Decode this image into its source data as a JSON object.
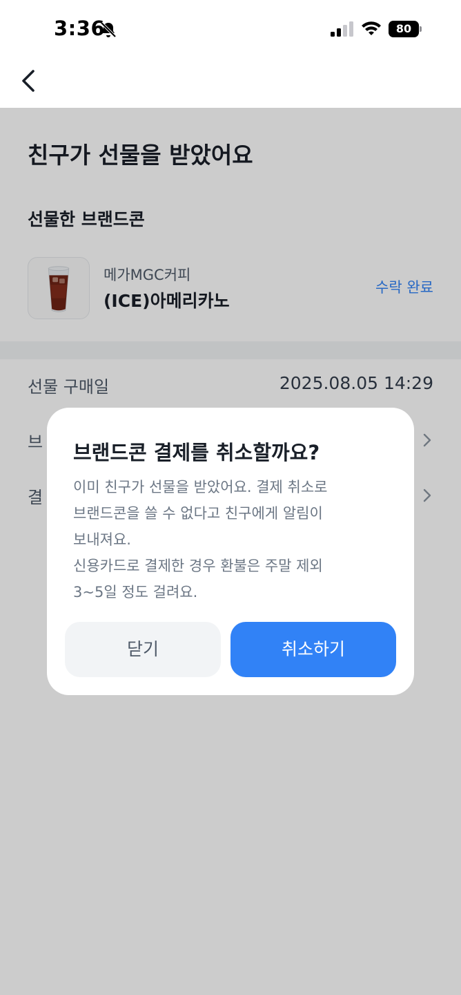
{
  "status_bar": {
    "time": "3:36",
    "battery": "80"
  },
  "page": {
    "title": "친구가 선물을 받았어요"
  },
  "gift": {
    "section_label": "선물한 브랜드콘",
    "brand": "메가MGC커피",
    "product": "(ICE)아메리카노",
    "status": "수락 완료"
  },
  "details": {
    "purchase_date_label": "선물 구매일",
    "purchase_date_value": "2025.08.05 14:29",
    "row2_label": "브",
    "row3_label": "결"
  },
  "dialog": {
    "title": "브랜드콘 결제를 취소할까요?",
    "body_lines": [
      "이미 친구가 선물을 받았어요. 결제 취소로",
      "브랜드콘을 쓸 수 없다고 친구에게 알림이",
      "보내져요.",
      "신용카드로 결제한 경우 환불은 주말 제외",
      "3~5일 정도 걸려요."
    ],
    "close_label": "닫기",
    "confirm_label": "취소하기"
  },
  "colors": {
    "accent": "#3182f6",
    "dim": "rgba(0,0,0,0.20)"
  },
  "icons": [
    "bell-off-icon",
    "signal-icon",
    "wifi-icon",
    "battery-icon",
    "back-arrow-icon",
    "iced-coffee-image",
    "chevron-right-icon"
  ]
}
